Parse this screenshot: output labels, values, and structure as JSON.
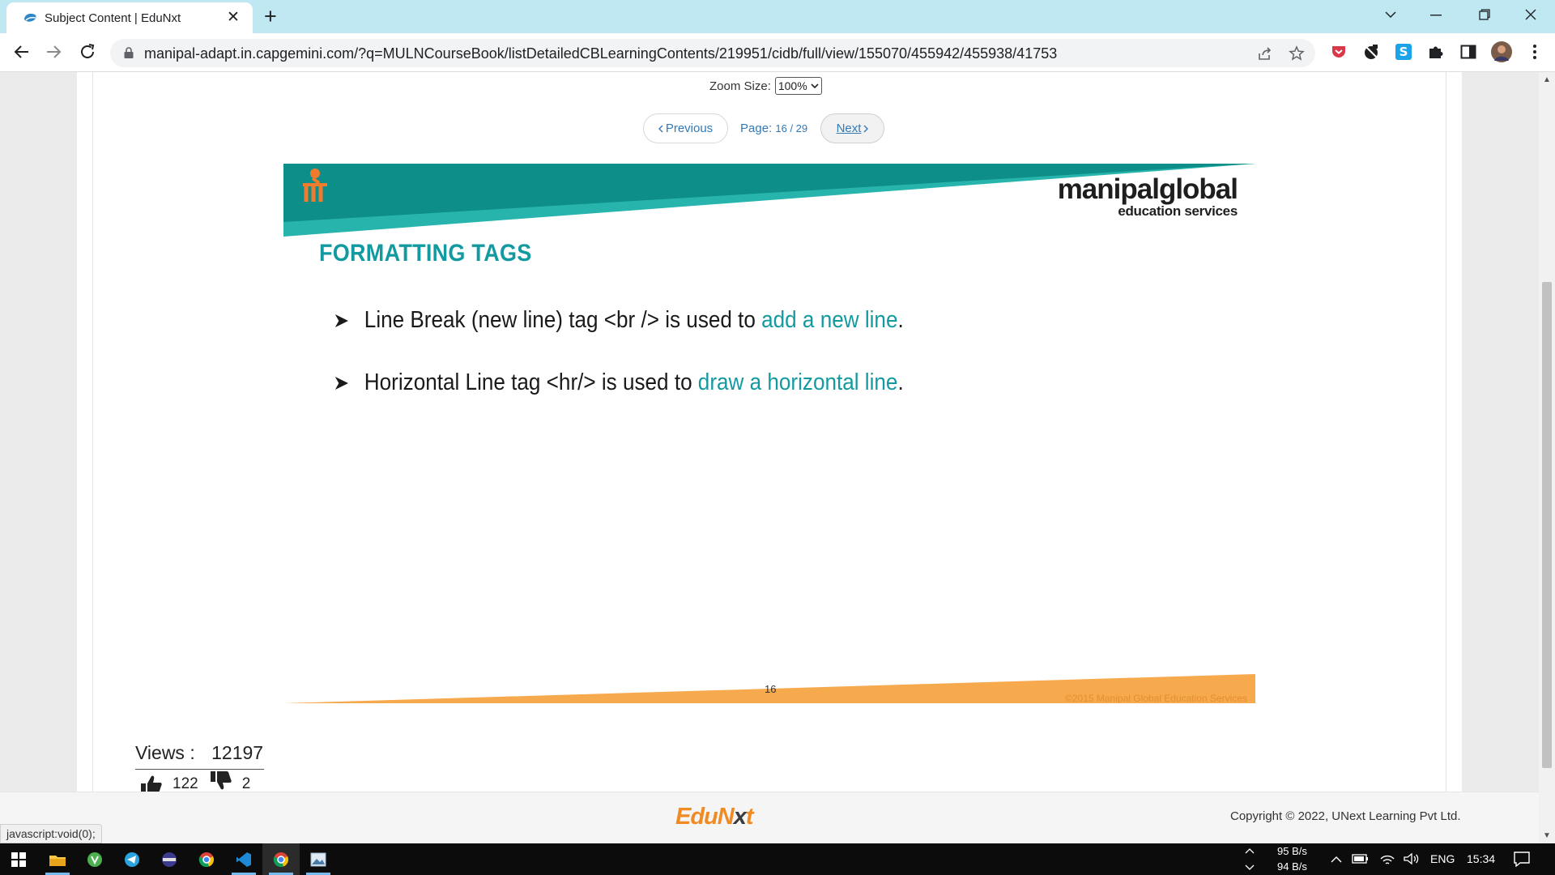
{
  "browser": {
    "tab_title": "Subject Content | EduNxt",
    "url": "manipal-adapt.in.capgemini.com/?q=MULNCourseBook/listDetailedCBLearningContents/219951/cidb/full/view/155070/455942/455938/41753",
    "icons": [
      "edunxt-favicon",
      "close-tab-icon",
      "new-tab-icon",
      "chevron-down-icon",
      "minimize-icon",
      "restore-icon",
      "close-window-icon",
      "back-icon",
      "forward-icon",
      "reload-icon",
      "lock-icon",
      "share-icon",
      "star-icon",
      "pocket-icon",
      "extension-icon",
      "s-extension-icon",
      "puzzle-icon",
      "sidepanel-icon",
      "avatar",
      "more-icon"
    ],
    "accent": "#bfe8f3"
  },
  "viewer": {
    "zoom_label": "Zoom Size:",
    "zoom_value": "100%",
    "prev_label": "Previous",
    "next_label": "Next",
    "page_label": "Page:",
    "page_current": "16 / 29"
  },
  "slide": {
    "brand_main": "manipalglobal",
    "brand_sub": "education services",
    "title": "FORMATTING TAGS",
    "bullets": [
      {
        "text": "Line Break (new line) tag <br /> is used to ",
        "highlight": "add a new line",
        "end": "."
      },
      {
        "text": "Horizontal Line tag <hr/> is used to ",
        "highlight": "draw a horizontal line",
        "end": "."
      }
    ],
    "page_number": "16",
    "copyright": "©2015 Manipal Global Education Services",
    "colors": {
      "teal": "#0e8e88",
      "teal_light": "#27b4ad",
      "orange": "#f6a94d"
    }
  },
  "stats": {
    "views_label": "Views :",
    "views_count": "12197",
    "likes": "122",
    "dislikes": "2"
  },
  "footer": {
    "logo_edu": "EduN",
    "logo_x": "x",
    "logo_t": "t",
    "copyright": "Copyright © 2022, UNext Learning Pvt Ltd.",
    "status_url": "javascript:void(0);"
  },
  "taskbar": {
    "apps": [
      "windows-start-icon",
      "file-explorer-icon",
      "green-app-icon",
      "telegram-icon",
      "app-icon",
      "chrome-icon",
      "vscode-icon",
      "chrome-active-icon",
      "photos-icon"
    ],
    "net_up": "95 B/s",
    "net_down": "94 B/s",
    "language": "ENG",
    "time": "15:34"
  }
}
